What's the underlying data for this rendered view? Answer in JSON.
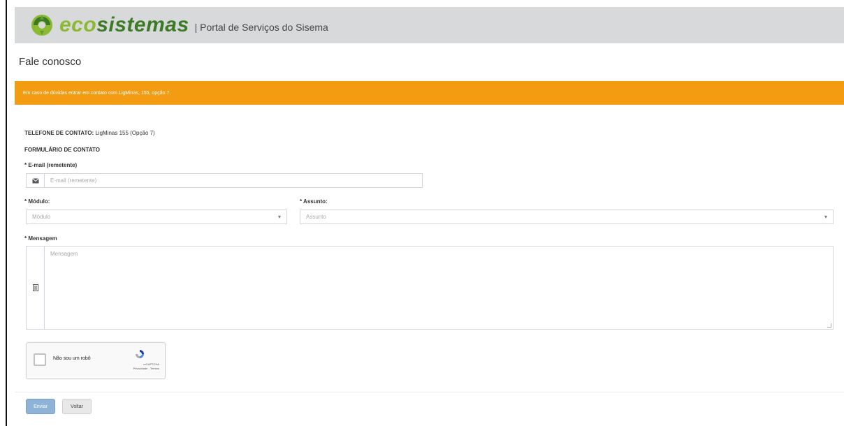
{
  "header": {
    "logo_eco": "eco",
    "logo_sistemas": "sistemas",
    "subtitle": "| Portal de Serviços do Sisema"
  },
  "page": {
    "title": "Fale conosco"
  },
  "alert": {
    "text": "Em caso de dúvidas entrar em contato com LigMinas, 155, opção 7.",
    "color": "#f39c12"
  },
  "contact": {
    "phone_label": "TELEFONE DE CONTATO:",
    "phone_value": "LigMinas 155 (Opção 7)",
    "form_title": "FORMULÁRIO DE CONTATO"
  },
  "form": {
    "email_label": "* E-mail (remetente)",
    "email_placeholder": "E-mail (remetente)",
    "email_icon": "envelope-icon",
    "modulo_label": "* Módulo:",
    "modulo_placeholder": "Módulo",
    "assunto_label": "* Assunto:",
    "assunto_placeholder": "Assunto",
    "mensagem_label": "* Mensagem",
    "mensagem_placeholder": "Mensagem",
    "mensagem_icon": "document-icon"
  },
  "captcha": {
    "label": "Não sou um robô",
    "brand": "reCAPTCHA",
    "links": "Privacidade - Termos"
  },
  "buttons": {
    "submit": "Enviar",
    "back": "Voltar"
  }
}
